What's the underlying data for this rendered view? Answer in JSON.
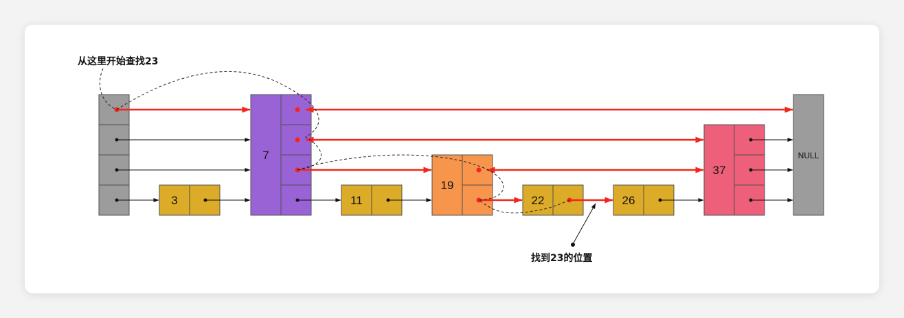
{
  "annotations": {
    "start_label": "从这里开始查找23",
    "found_label": "找到23的位置"
  },
  "nodes": [
    {
      "value": "3"
    },
    {
      "value": "7"
    },
    {
      "value": "11"
    },
    {
      "value": "19"
    },
    {
      "value": "22"
    },
    {
      "value": "26"
    },
    {
      "value": "37"
    }
  ],
  "tail": {
    "label": "NULL"
  },
  "colors": {
    "head": "#9c9c9c",
    "tail": "#9c9c9c",
    "gold": "#dcab27",
    "purple": "#9a63d5",
    "orange": "#f7954c",
    "pink": "#ee607a",
    "search_path": "#f2261c",
    "pointer": "#111111"
  }
}
